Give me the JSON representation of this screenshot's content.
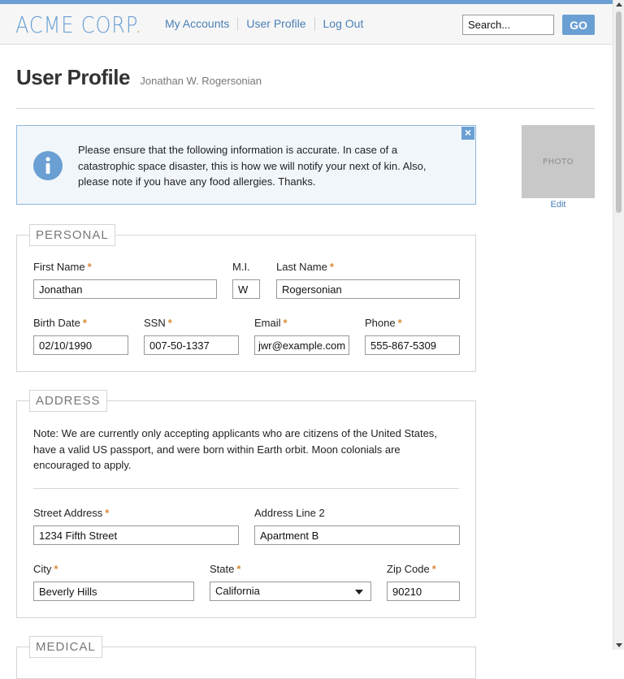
{
  "brand": {
    "logo_text": "ACME CORP",
    "logo_dot": ".",
    "accent": "#6a9fd3",
    "highlight": "#d98a3a"
  },
  "nav": {
    "items": [
      {
        "label": "My Accounts"
      },
      {
        "label": "User Profile"
      },
      {
        "label": "Log Out"
      }
    ]
  },
  "search": {
    "value": "Search...",
    "go_label": "GO"
  },
  "page": {
    "title": "User Profile",
    "subtitle": "Jonathan W. Rogersonian"
  },
  "notice": {
    "text": "Please ensure that the following information is accurate. In case of a catastrophic space disaster, this is how we will notify your next of kin. Also, please note if you have any food allergies. Thanks.",
    "icon": "info-icon",
    "close_icon": "close-icon",
    "close_glyph": "×"
  },
  "photo": {
    "placeholder": "PHOTO",
    "edit_label": "Edit"
  },
  "required_mark": "*",
  "personal": {
    "legend": "PERSONAL",
    "first_name": {
      "label": "First Name",
      "value": "Jonathan"
    },
    "middle_initial": {
      "label": "M.I.",
      "value": "W"
    },
    "last_name": {
      "label": "Last Name",
      "value": "Rogersonian"
    },
    "birth_date": {
      "label": "Birth Date",
      "value": "02/10/1990"
    },
    "ssn": {
      "label": "SSN",
      "value": "007-50-1337"
    },
    "email": {
      "label": "Email",
      "value": "jwr@example.com"
    },
    "phone": {
      "label": "Phone",
      "value": "555-867-5309"
    }
  },
  "address": {
    "legend": "ADDRESS",
    "note": "Note: We are currently only accepting applicants who are citizens of the United States, have a valid US passport, and were born within Earth orbit. Moon colonials are encouraged to apply.",
    "street": {
      "label": "Street Address",
      "value": "1234 Fifth Street"
    },
    "line2": {
      "label": "Address Line 2",
      "value": "Apartment B"
    },
    "city": {
      "label": "City",
      "value": "Beverly Hills"
    },
    "state": {
      "label": "State",
      "value": "California"
    },
    "zip": {
      "label": "Zip Code",
      "value": "90210"
    }
  },
  "medical": {
    "legend": "MEDICAL"
  }
}
